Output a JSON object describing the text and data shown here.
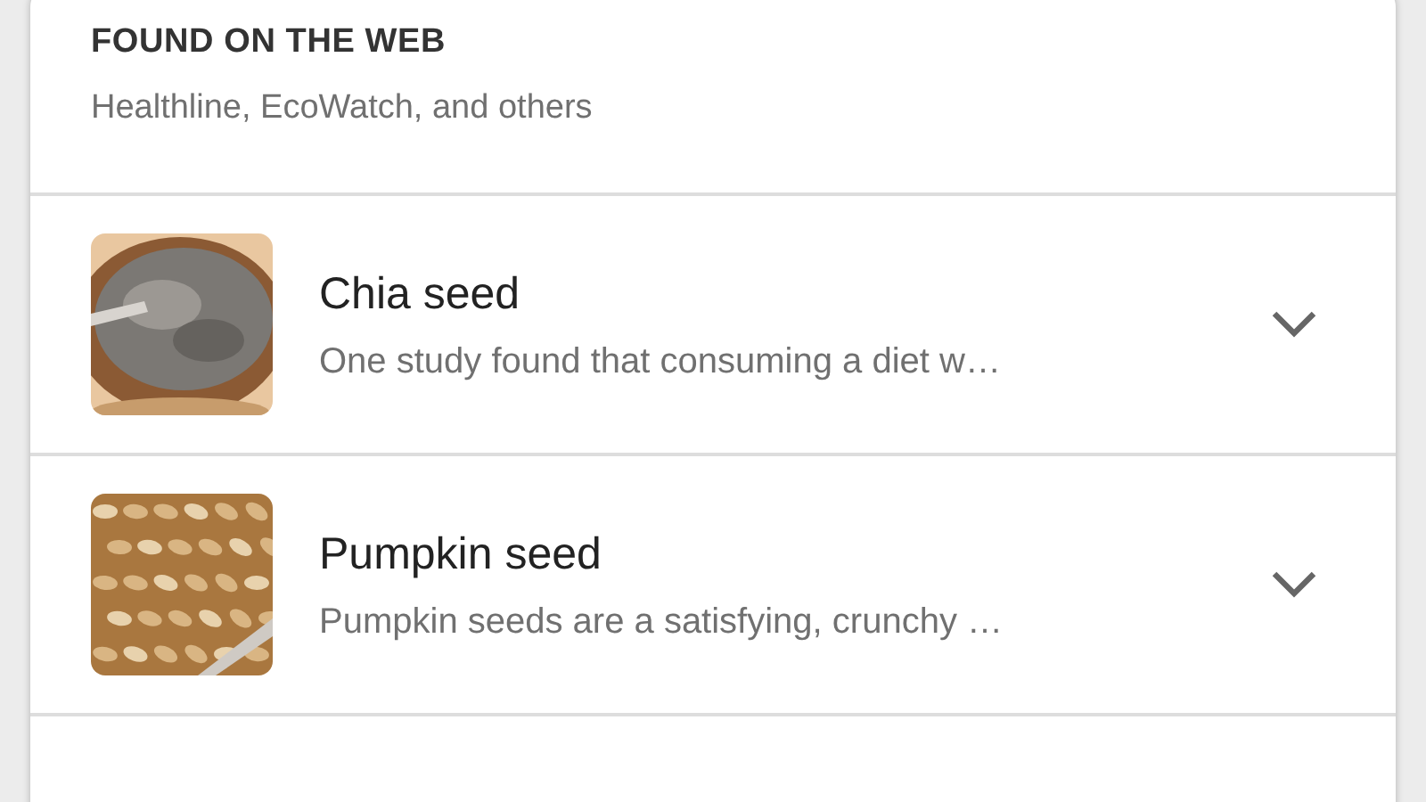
{
  "header": {
    "title": "FOUND ON THE WEB",
    "sources": "Healthline, EcoWatch, and others"
  },
  "results": [
    {
      "thumbnail": {
        "kind": "chia"
      },
      "title": "Chia seed",
      "snippet": "One study found that consuming a diet w…",
      "expanded": false
    },
    {
      "thumbnail": {
        "kind": "pumpkin"
      },
      "title": "Pumpkin seed",
      "snippet": "Pumpkin seeds are a satisfying, crunchy …",
      "expanded": false
    }
  ]
}
